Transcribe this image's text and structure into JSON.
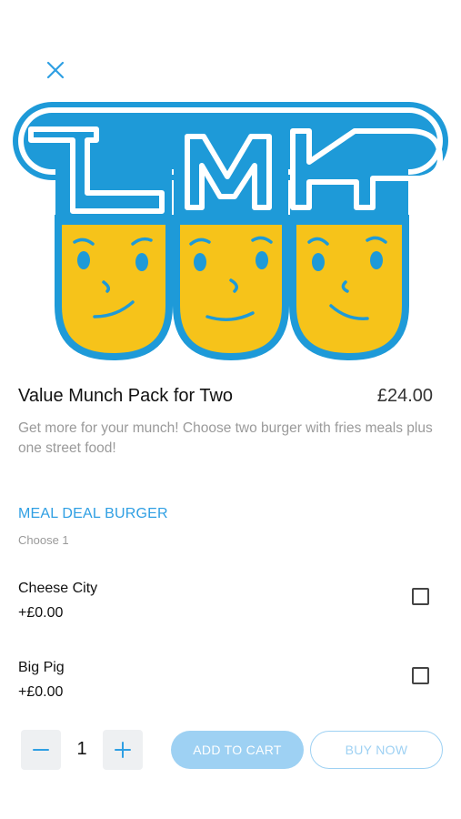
{
  "header": {
    "close_icon": "close-icon"
  },
  "hero": {
    "logo_text": "LMK"
  },
  "product": {
    "title": "Value Munch Pack for Two",
    "price": "£24.00",
    "description": "Get more for your munch! Choose two burger with fries meals plus one street food!"
  },
  "section": {
    "title": "MEAL DEAL BURGER",
    "subtitle": "Choose 1",
    "options": [
      {
        "name": "Cheese City",
        "price": "+£0.00",
        "checked": false
      },
      {
        "name": "Big Pig",
        "price": "+£0.00",
        "checked": false
      }
    ]
  },
  "footer": {
    "quantity": "1",
    "add_to_cart_label": "ADD TO CART",
    "buy_now_label": "BUY NOW"
  },
  "colors": {
    "accent": "#2f9fe3",
    "button_light": "#9ed1f3",
    "logo_blue": "#1e9ad8",
    "logo_yellow": "#f6c31a"
  }
}
